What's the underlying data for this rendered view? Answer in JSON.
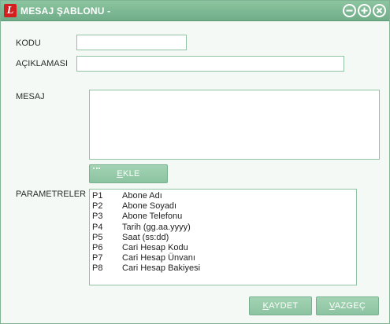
{
  "window": {
    "title": "MESAJ ŞABLONU -",
    "logo_letter": "L",
    "controls": [
      "minimize-icon",
      "maximize-icon",
      "close-icon"
    ]
  },
  "form": {
    "kodu_label": "KODU",
    "kodu_value": "",
    "aciklama_label": "AÇIKLAMASI",
    "aciklama_value": "",
    "mesaj_label": "MESAJ",
    "mesaj_value": "",
    "ekle_button": {
      "underlined": "E",
      "rest": "KLE"
    },
    "parametreler_label": "PARAMETRELER"
  },
  "parameters": [
    {
      "code": "P1",
      "name": "Abone Adı"
    },
    {
      "code": "P2",
      "name": "Abone Soyadı"
    },
    {
      "code": "P3",
      "name": "Abone Telefonu"
    },
    {
      "code": "P4",
      "name": "Tarih (gg.aa.yyyy)"
    },
    {
      "code": "P5",
      "name": "Saat (ss:dd)"
    },
    {
      "code": "P6",
      "name": "Cari Hesap Kodu"
    },
    {
      "code": "P7",
      "name": "Cari Hesap Ünvanı"
    },
    {
      "code": "P8",
      "name": "Cari Hesap Bakiyesi"
    }
  ],
  "footer": {
    "kaydet": {
      "underlined": "K",
      "rest": "AYDET"
    },
    "vazgec": {
      "underlined": "V",
      "rest": "AZGEÇ"
    }
  },
  "colors": {
    "titlebar": "#7dba95",
    "accent": "#8fc3a4",
    "logo": "#d31f1f"
  }
}
